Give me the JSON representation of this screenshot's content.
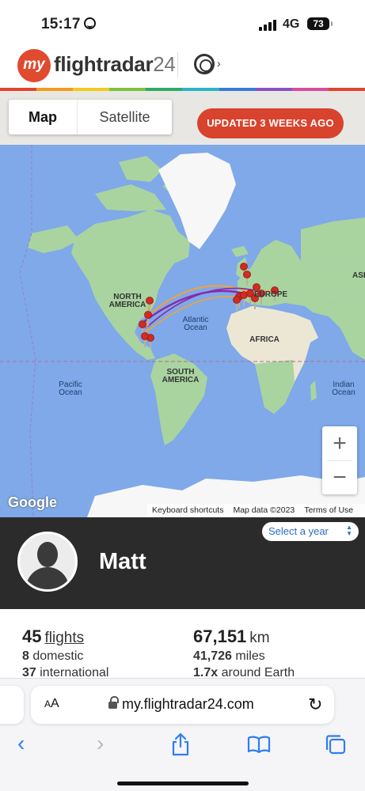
{
  "status_bar": {
    "time": "15:17",
    "network": "4G",
    "battery": "73"
  },
  "header": {
    "logo_my": "my",
    "logo_name": "flightradar",
    "logo_num": "24"
  },
  "rainbow_colors": [
    "#e0442c",
    "#f29a1f",
    "#f4c91d",
    "#7cc242",
    "#2eaa66",
    "#2ab3c9",
    "#3a7bd5",
    "#8d4fc4",
    "#d84a9b",
    "#e0442c"
  ],
  "map": {
    "toggle_map": "Map",
    "toggle_satellite": "Satellite",
    "updated": "UPDATED 3 WEEKS AGO",
    "zoom_in": "+",
    "zoom_out": "−",
    "google": "Google",
    "footer": {
      "shortcuts": "Keyboard shortcuts",
      "data": "Map data ©2023",
      "terms": "Terms of Use"
    },
    "labels": {
      "north_america_1": "NORTH",
      "north_america_2": "AMERICA",
      "south_america_1": "SOUTH",
      "south_america_2": "AMERICA",
      "europe": "EUROPE",
      "africa": "AFRICA",
      "asia": "ASIA",
      "atlantic_1": "Atlantic",
      "atlantic_2": "Ocean",
      "pacific_1": "Pacific",
      "pacific_2": "Ocean",
      "indian_1": "Indian",
      "indian_2": "Ocean"
    },
    "colors": {
      "water": "#7fa9e8",
      "land": "#a9d4a0",
      "ice": "#f7f7f7",
      "desert": "#ece7d4",
      "pin": "#d32a21",
      "route_a": "#8a2aa8",
      "route_b": "#f0a23a"
    }
  },
  "profile": {
    "name": "Matt",
    "year_select": "Select a year"
  },
  "stats": {
    "flights_count": "45",
    "flights_label": "flights",
    "domestic_count": "8",
    "domestic_label": "domestic",
    "international_count": "37",
    "international_label": "international",
    "km_count": "67,151",
    "km_label": "km",
    "miles_count": "41,726",
    "miles_label": "miles",
    "earth_count": "1.7x",
    "earth_label": "around Earth"
  },
  "browser": {
    "aa": "AA",
    "url": "my.flightradar24.com"
  }
}
